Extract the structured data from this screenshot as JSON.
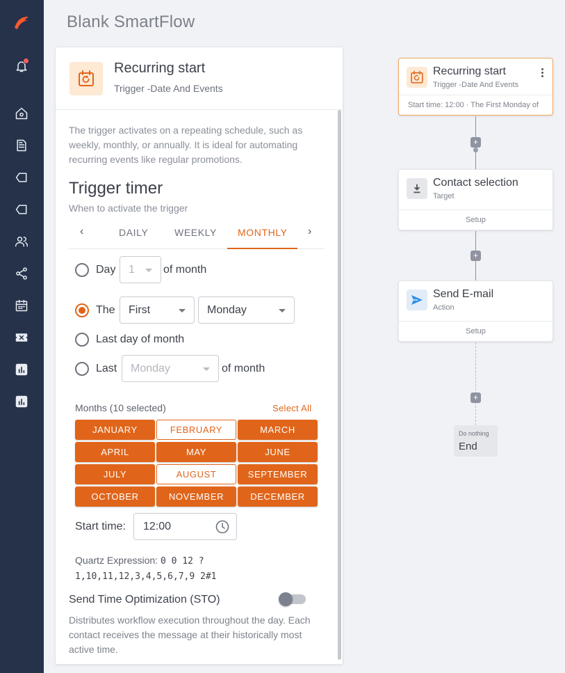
{
  "app": {
    "title": "Blank SmartFlow"
  },
  "sidebar": {
    "items": [
      "logo-icon",
      "bell-icon",
      "home-icon",
      "document-icon",
      "tag-icon",
      "label-icon",
      "users-icon",
      "share-icon",
      "calendar-icon",
      "ticket-icon",
      "report-icon",
      "analytics-icon"
    ]
  },
  "panel": {
    "title": "Recurring start",
    "subtitle": "Trigger -Date And Events",
    "description": "The trigger activates on a repeating schedule, such as weekly, monthly, or annually. It is ideal for automating recurring events like regular promotions.",
    "timer_title": "Trigger timer",
    "timer_subtitle": "When to activate the trigger",
    "tabs": [
      "DAILY",
      "WEEKLY",
      "MONTHLY"
    ],
    "active_tab": "MONTHLY",
    "options": {
      "day_label": "Day",
      "day_value": "1",
      "of_month": "of month",
      "the_label": "The",
      "the_ordinal": "First",
      "the_weekday": "Monday",
      "last_day_label": "Last day of month",
      "last_label": "Last",
      "last_weekday_placeholder": "Monday",
      "last_of_month": "of month",
      "selected": "the"
    },
    "months_label": "Months (10 selected)",
    "select_all": "Select All",
    "months": [
      {
        "name": "JANUARY",
        "selected": true
      },
      {
        "name": "FEBRUARY",
        "selected": false
      },
      {
        "name": "MARCH",
        "selected": true
      },
      {
        "name": "APRIL",
        "selected": true
      },
      {
        "name": "MAY",
        "selected": true
      },
      {
        "name": "JUNE",
        "selected": true
      },
      {
        "name": "JULY",
        "selected": true
      },
      {
        "name": "AUGUST",
        "selected": false
      },
      {
        "name": "SEPTEMBER",
        "selected": true
      },
      {
        "name": "OCTOBER",
        "selected": true
      },
      {
        "name": "NOVEMBER",
        "selected": true
      },
      {
        "name": "DECEMBER",
        "selected": true
      }
    ],
    "start_time_label": "Start time:",
    "start_time": "12:00",
    "quartz_label": "Quartz Expression:",
    "quartz_part1": "0 0 12 ?",
    "quartz_part2": "1,10,11,12,3,4,5,6,7,9 2#1",
    "sto_title": "Send Time Optimization (STO)",
    "sto_enabled": false,
    "sto_description": "Distributes workflow execution throughout the day. Each contact receives the message at their historically most active time."
  },
  "flow": {
    "trigger": {
      "title": "Recurring start",
      "subtitle": "Trigger -Date And Events",
      "footer": "Start time: 12:00 · The First Monday of"
    },
    "contact": {
      "title": "Contact selection",
      "subtitle": "Target",
      "footer": "Setup"
    },
    "email": {
      "title": "Send E-mail",
      "subtitle": "Action",
      "footer": "Setup"
    },
    "end": {
      "subtitle": "Do nothing",
      "title": "End"
    },
    "plus": "+"
  },
  "colors": {
    "accent": "#e0651a",
    "sidebar": "#25324a",
    "email_icon": "#2f8fe8"
  }
}
